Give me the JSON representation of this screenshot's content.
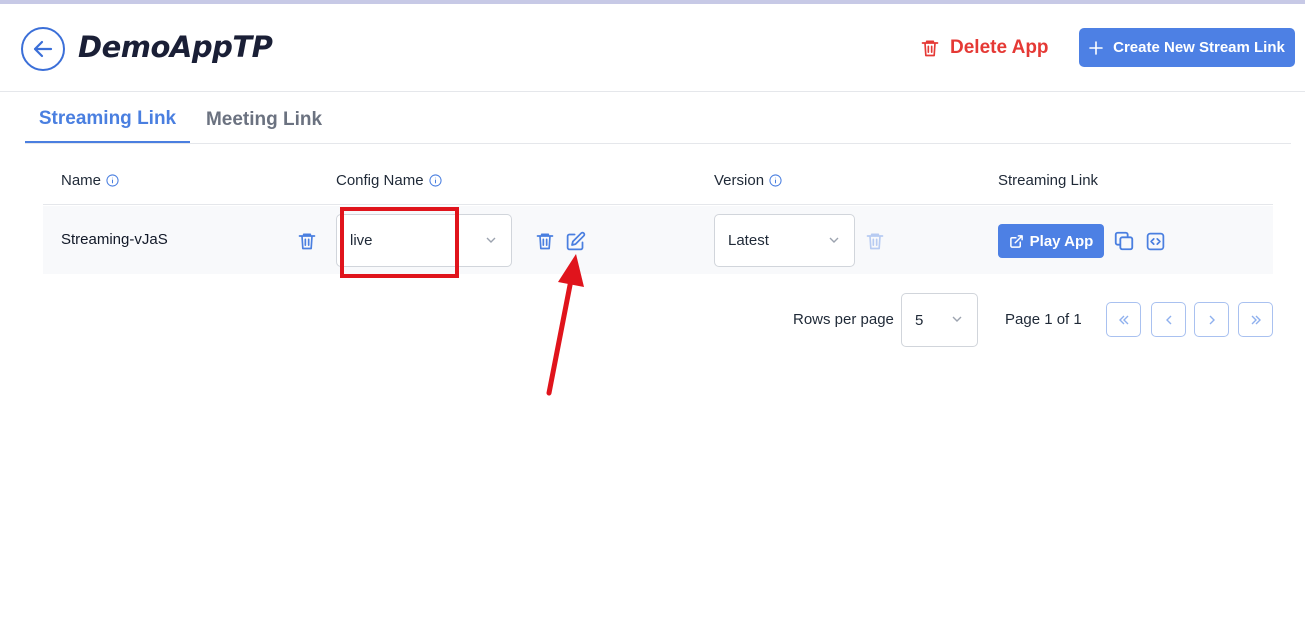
{
  "header": {
    "title": "DemoAppTP",
    "delete_label": "Delete App",
    "create_label": "Create New Stream Link"
  },
  "tabs": [
    {
      "label": "Streaming Link",
      "active": true
    },
    {
      "label": "Meeting Link",
      "active": false
    }
  ],
  "table": {
    "columns": [
      "Name",
      "Config Name",
      "Version",
      "Streaming Link"
    ],
    "rows": [
      {
        "name": "Streaming-vJaS",
        "config": "live",
        "version": "Latest",
        "play_label": "Play App"
      }
    ]
  },
  "pagination": {
    "rows_per_page_label": "Rows per page",
    "rows_per_page_value": "5",
    "page_info": "Page 1 of 1"
  },
  "colors": {
    "accent": "#4d80e4",
    "danger": "#e53935",
    "annotation": "#e0141c"
  }
}
